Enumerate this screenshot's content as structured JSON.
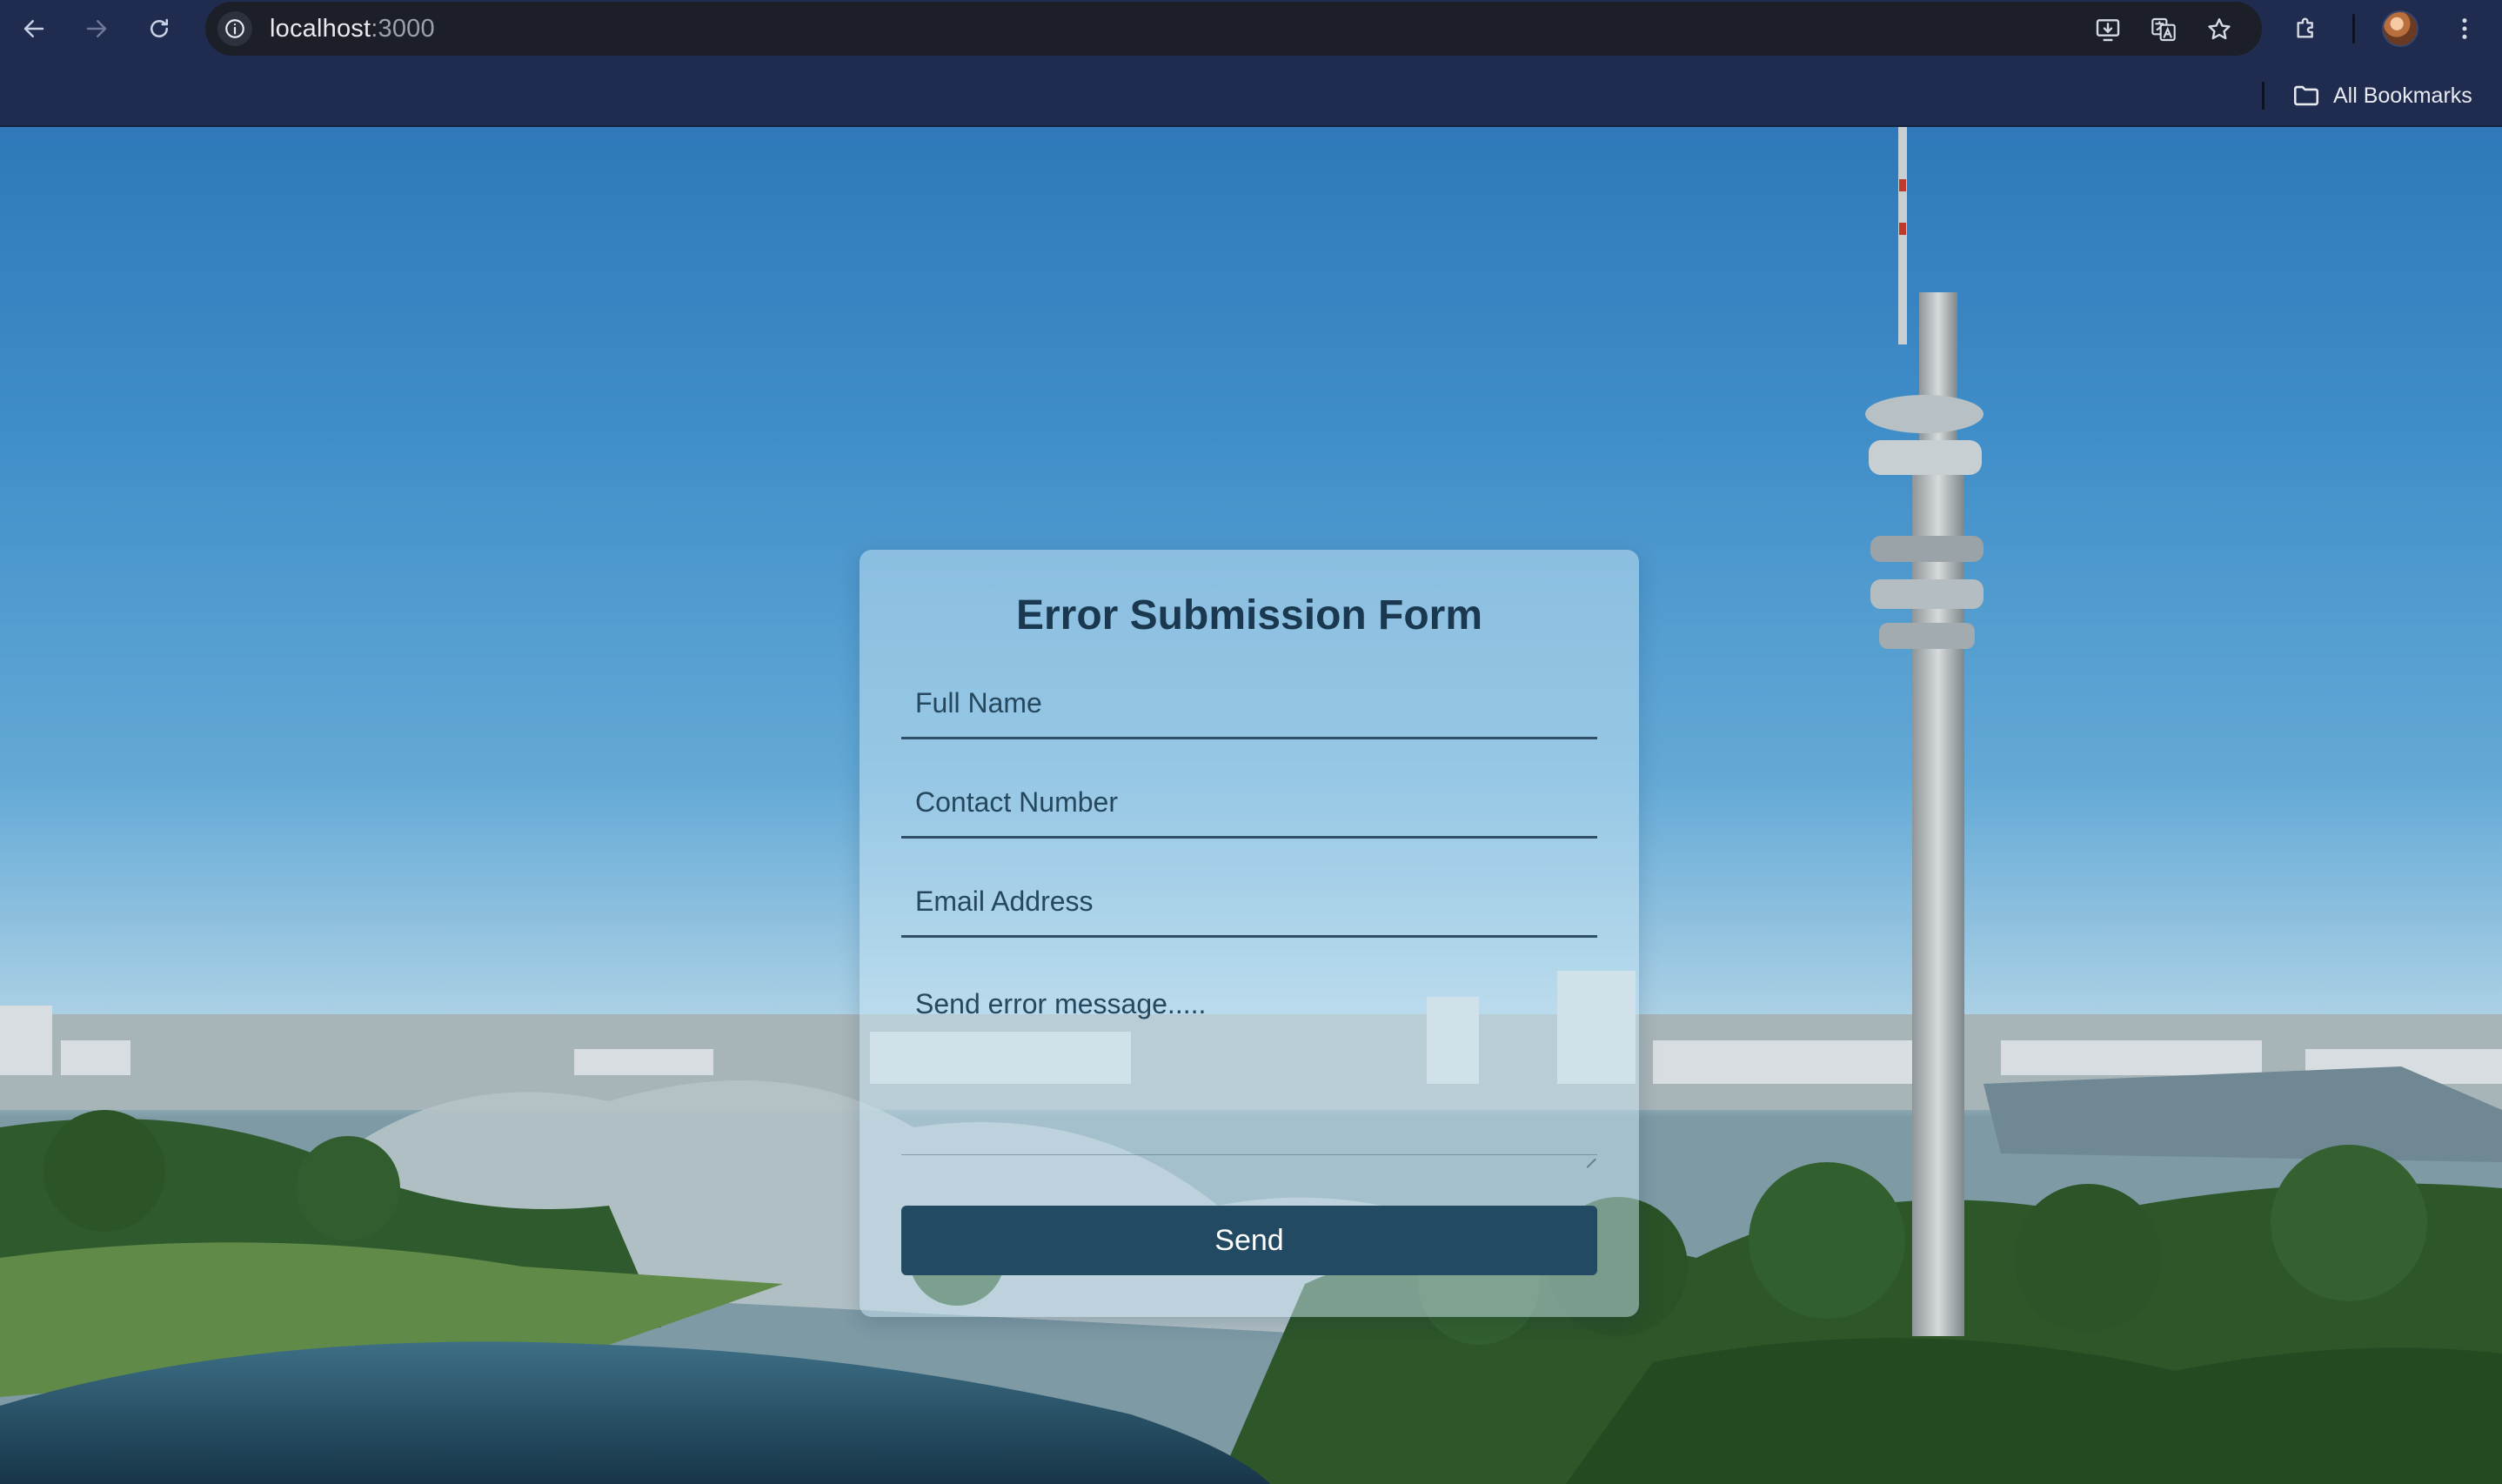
{
  "browser": {
    "url_host": "localhost",
    "url_port": ":3000",
    "bookmarks_label": "All Bookmarks",
    "icons": {
      "back": "arrow-left-icon",
      "forward": "arrow-right-icon",
      "reload": "reload-icon",
      "site_info": "info-icon",
      "install": "install-app-icon",
      "translate": "translate-icon",
      "bookmark": "star-icon",
      "extensions": "puzzle-icon",
      "menu": "kebab-menu-icon",
      "bookmarks_folder": "folder-icon"
    }
  },
  "form": {
    "title": "Error Submission Form",
    "full_name_placeholder": "Full Name",
    "contact_placeholder": "Contact Number",
    "email_placeholder": "Email Address",
    "message_placeholder": "Send error message.....",
    "send_label": "Send"
  },
  "colors": {
    "chrome": "#1f2c4f",
    "omnibox": "#1c1f27",
    "button": "#224a62",
    "title": "#1a3950"
  }
}
